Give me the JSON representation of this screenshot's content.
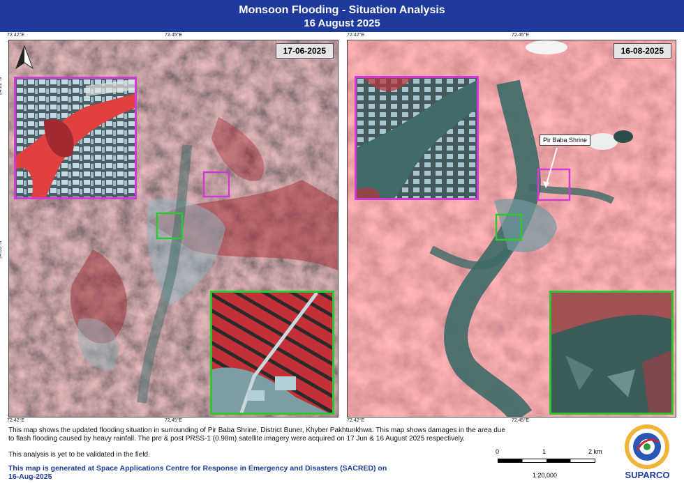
{
  "header": {
    "title": "Monsoon Flooding - Situation Analysis",
    "subtitle": "16 August 2025"
  },
  "panels": {
    "left": {
      "date": "17-06-2025"
    },
    "right": {
      "date": "16-08-2025",
      "callout": "Pir Baba Shrine"
    }
  },
  "coords": {
    "lon_left": "72.42°E",
    "lon_mid": "72.45°E",
    "lat_top": "34.62°N",
    "lat_mid": "34.59°N"
  },
  "footer": {
    "desc1": "This map shows the updated flooding situation in surrounding of Pir Baba Shrine, District Buner, Khyber Pakhtunkhwa. This map shows damages in the area due",
    "desc2": "to flash flooding caused by heavy rainfall. The pre & post PRSS-1 (0.98m) satellite imagery were acquired on 17 Jun & 16 August 2025 respectively.",
    "validation": "This analysis is yet to be validated in the field.",
    "credit1": "This map is generated at Space Applications Centre for Response in Emergency and Disasters (SACRED) on",
    "credit2": "16-Aug-2025"
  },
  "scale": {
    "ticks": [
      "0",
      "1",
      "2 km"
    ],
    "ratio": "1:20,000"
  },
  "logo": {
    "name": "SUPARCO"
  },
  "colors": {
    "banner": "#1d3a9c",
    "inset_magenta": "#d23ad6",
    "inset_green": "#2ec82e"
  }
}
